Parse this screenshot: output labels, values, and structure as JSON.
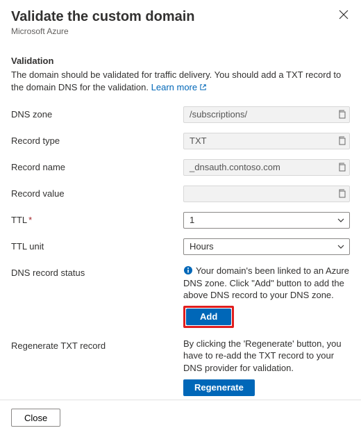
{
  "header": {
    "title": "Validate the custom domain",
    "subtitle": "Microsoft Azure"
  },
  "validation": {
    "section_title": "Validation",
    "description": "The domain should be validated for traffic delivery. You should add a TXT record to the domain DNS for the validation.",
    "learn_more": "Learn more"
  },
  "fields": {
    "dns_zone": {
      "label": "DNS zone",
      "value": "/subscriptions/"
    },
    "record_type": {
      "label": "Record type",
      "value": "TXT"
    },
    "record_name": {
      "label": "Record name",
      "value": "_dnsauth.contoso.com"
    },
    "record_value": {
      "label": "Record value",
      "value": ""
    },
    "ttl": {
      "label": "TTL",
      "value": "1"
    },
    "ttl_unit": {
      "label": "TTL unit",
      "value": "Hours"
    }
  },
  "status": {
    "label": "DNS record status",
    "text": "Your domain's been linked to an Azure DNS zone. Click \"Add\" button to add the above DNS record to your DNS zone.",
    "add_button": "Add"
  },
  "regenerate": {
    "label": "Regenerate TXT record",
    "text": "By clicking the 'Regenerate' button, you have to re-add the TXT record to your DNS provider for validation.",
    "button": "Regenerate"
  },
  "footer": {
    "close": "Close"
  }
}
